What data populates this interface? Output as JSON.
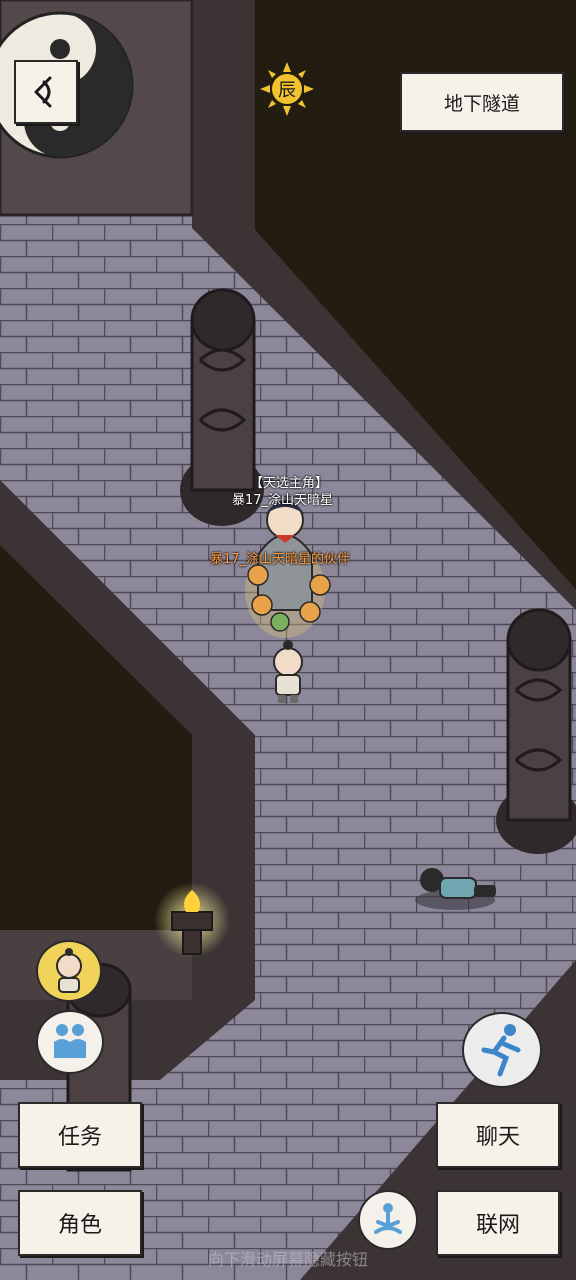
{
  "location_name": "地下隧道",
  "time_glyph": "辰",
  "player": {
    "title": "【天选主角】",
    "name": "暴17_涂山天暗星",
    "companion_label": "暴17_涂山天暗星的伙伴"
  },
  "buttons": {
    "task": "任务",
    "role": "角色",
    "chat": "聊天",
    "network": "联网"
  },
  "hint": "向下滑动屏幕隐藏按钮",
  "colors": {
    "floor": "#8a8697",
    "wall": "#3a3032",
    "player_name": "#ffffff",
    "companion_name": "#ff9a3c"
  }
}
